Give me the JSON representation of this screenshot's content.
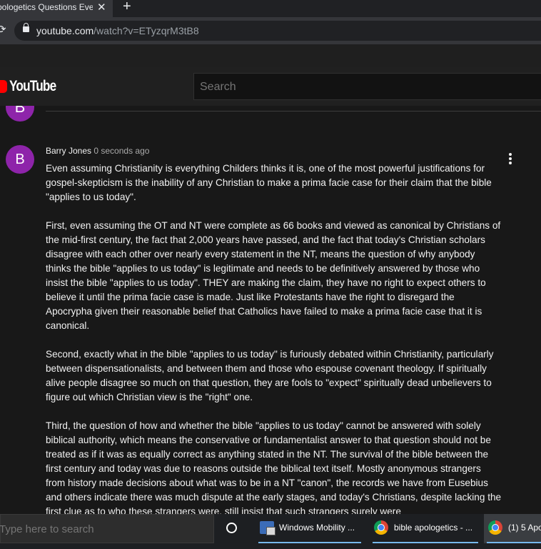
{
  "browser": {
    "tab_title": "pologetics Questions Every",
    "tab_close": "✕",
    "new_tab": "+",
    "url_host": "youtube.com",
    "url_path": "/watch?v=ETyzqrM3tB8"
  },
  "youtube": {
    "logo_text": "YouTube",
    "search_placeholder": "Search"
  },
  "comment": {
    "prev_avatar_letter": "B",
    "avatar_letter": "B",
    "author": "Barry Jones",
    "timestamp": "0 seconds ago",
    "paragraphs": [
      "Even assuming Christianity is everything Childers thinks it is, one of the most powerful justifications for gospel-skepticism is the inability of any Christian to make a prima facie case for their claim that the bible \"applies to us today\".",
      "First, even assuming the OT and NT were complete as 66 books and viewed as canonical by Christians of the mid-first century, the fact that 2,000 years have passed, and the fact that today's Christian scholars disagree with each other over nearly every statement in the NT, means the question of why anybody thinks the bible \"applies to us today\" is legitimate and needs to be definitively answered by those who insist the bible \"applies to us today\".  THEY are making the claim, they have no right to expect others to believe it until the prima facie case is made.  Just like Protestants have the right to disregard the Apocrypha given their reasonable belief that Catholics have failed to make a prima facie case that it is canonical.",
      "Second, exactly what in the bible \"applies to us today\" is furiously debated within Christianity, particularly between dispensationalists, and between them and those who espouse covenant theology.   If spiritually alive people disagree so much on that question, they are fools to \"expect\" spiritually dead unbelievers to figure out which Christian view is the \"right\" one.",
      "Third, the question of how and whether the bible \"applies to us today\" cannot be answered with solely biblical authority, which means the conservative or fundamentalist answer to that question should not be treated as if it was as equally correct as anything stated in the NT.  The survival of the bible between the first century and today was due to reasons outside the biblical text itself.  Mostly anonymous strangers from history made decisions about what was to be in a NT \"canon\", the records we have from Eusebius and others indicate there was much dispute at the early stages, and today's Christians, despite lacking the first clue as to who these strangers were, still insist that such strangers surely were"
    ]
  },
  "taskbar": {
    "search_placeholder": "Type here to search",
    "items": [
      {
        "label": "Windows Mobility ...",
        "icon": "windows-mobility-icon"
      },
      {
        "label": "bible apologetics - ...",
        "icon": "chrome-icon"
      },
      {
        "label": "(1) 5 Apo",
        "icon": "chrome-icon"
      }
    ]
  }
}
